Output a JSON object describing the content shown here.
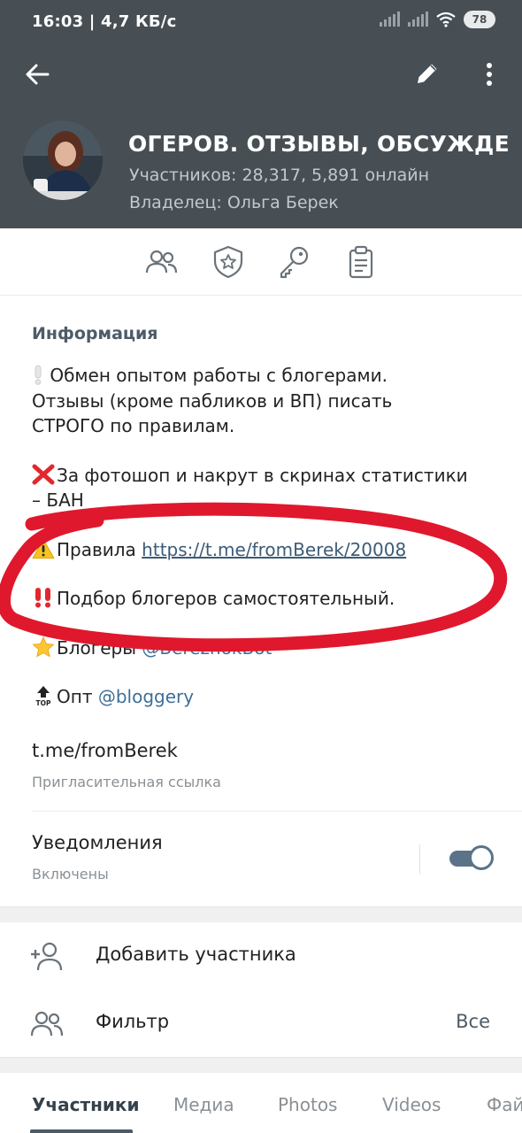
{
  "status_bar": {
    "time": "16:03",
    "speed": "4,7 КБ/с",
    "battery": "78"
  },
  "header": {
    "title": "БЛОГЕРОВ. ОТЗЫВЫ, ОБСУЖДЕ",
    "members": "Участников: 28,317, 5,891 онлайн",
    "owner": "Владелец:  Ольга Берек"
  },
  "action_icons": [
    "members-icon",
    "shield-star-icon",
    "key-icon",
    "clipboard-icon"
  ],
  "info": {
    "section_title": "Информация",
    "line_intro_1": "Обмен опытом работы с блогерами.",
    "line_intro_2": "Отзывы (кроме пабликов и ВП) писать",
    "line_intro_3": "СТРОГО по правилам.",
    "line_ban_1": "За фотошоп и накрут в скринах статистики",
    "line_ban_2": "– БАН",
    "rules_label": "Правила ",
    "rules_link": "https://t.me/fromBerek/20008",
    "selection_line": "Подбор блогеров самостоятельный.",
    "bloggers_label": "Блогеры ",
    "bloggers_mention": "@BereznokBot",
    "opt_label": "Опт ",
    "opt_mention": "@bloggery",
    "invite_link": "t.me/fromBerek",
    "invite_label": "Пригласительная ссылка",
    "notifications_title": "Уведомления",
    "notifications_status": "Включены"
  },
  "list": {
    "add_member": "Добавить участника",
    "filter": "Фильтр",
    "filter_value": "Все"
  },
  "tabs": [
    "Участники",
    "Медиа",
    "Photos",
    "Videos",
    "Фай"
  ],
  "colors": {
    "header_bg": "#474f55",
    "accent": "#4a5a68",
    "link": "#3d5b77",
    "annotation_red": "#e0182d"
  }
}
